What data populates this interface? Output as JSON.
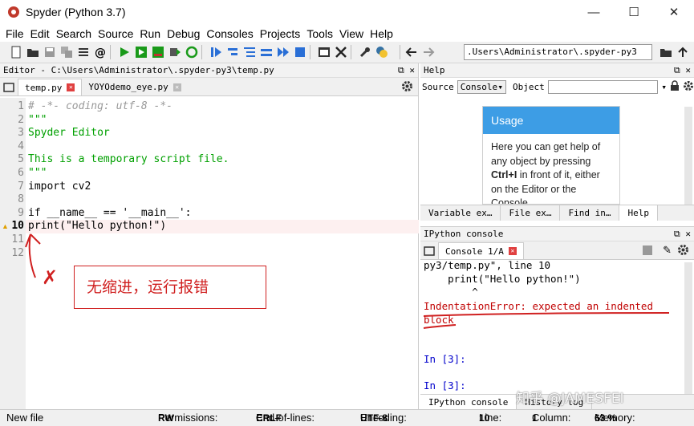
{
  "window": {
    "title": "Spyder (Python 3.7)",
    "minimize": "—",
    "maximize": "☐",
    "close": "✕"
  },
  "menu": [
    "File",
    "Edit",
    "Search",
    "Source",
    "Run",
    "Debug",
    "Consoles",
    "Projects",
    "Tools",
    "View",
    "Help"
  ],
  "toolbar": {
    "path": ".Users\\Administrator\\.spyder-py3"
  },
  "editor": {
    "header": "Editor - C:\\Users\\Administrator\\.spyder-py3\\temp.py",
    "tabs": [
      {
        "label": "temp.py"
      },
      {
        "label": "YOYOdemo_eye.py"
      }
    ],
    "lines": [
      {
        "n": "1",
        "text": "# -*- coding: utf-8 -*-"
      },
      {
        "n": "2",
        "text": "\"\"\""
      },
      {
        "n": "3",
        "text": "Spyder Editor"
      },
      {
        "n": "4",
        "text": ""
      },
      {
        "n": "5",
        "text": "This is a temporary script file."
      },
      {
        "n": "6",
        "text": "\"\"\""
      },
      {
        "n": "7",
        "text": "import cv2"
      },
      {
        "n": "8",
        "text": ""
      },
      {
        "n": "9",
        "text": "if __name__ == '__main__':"
      },
      {
        "n": "10",
        "text": "print(\"Hello python!\")"
      },
      {
        "n": "11",
        "text": ""
      },
      {
        "n": "12",
        "text": ""
      }
    ],
    "annotation_text": "无缩进，运行报错",
    "annotation_mark": "✗"
  },
  "help": {
    "header": "Help",
    "source_label": "Source",
    "source_value": "Console",
    "object_label": "Object",
    "usage_title": "Usage",
    "usage_text_1": "Here you can get help of any object by pressing",
    "usage_bold": "Ctrl+I",
    "usage_text_2": "in front of it, either on the Editor or the Console.",
    "tabs": [
      "Variable ex…",
      "File ex…",
      "Find in…",
      "Help"
    ]
  },
  "console": {
    "header": "IPython console",
    "tab": "Console 1/A",
    "lines": [
      "py3/temp.py\", line 10",
      "    print(\"Hello python!\")",
      "        ^",
      "IndentationError: expected an indented",
      "block",
      "",
      "",
      "In [3]:",
      "",
      "In [3]:"
    ],
    "bottom_tabs": [
      "IPython console",
      "History log"
    ]
  },
  "statusbar": {
    "left": "New file",
    "permissions_label": "Permissions:",
    "permissions": "RW",
    "eol_label": "End-of-lines:",
    "eol": "CRLF",
    "encoding_label": "Encoding:",
    "encoding": "UTF-8",
    "line_label": "Line:",
    "line": "10",
    "column_label": "Column:",
    "column": "1",
    "memory_label": "Memory:",
    "memory": "63 %"
  },
  "watermark": "知乎 @JAMESFEI"
}
